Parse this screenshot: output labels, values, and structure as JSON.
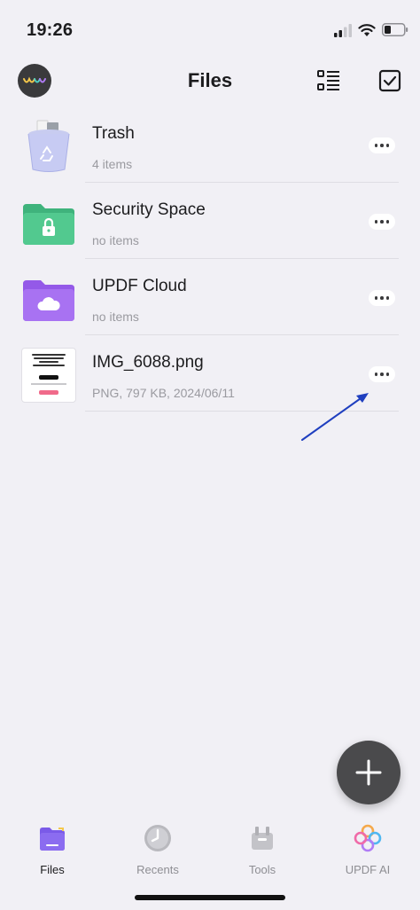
{
  "status_bar": {
    "time": "19:26"
  },
  "header": {
    "title": "Files"
  },
  "files": [
    {
      "name": "Trash",
      "meta": "4 items",
      "icon": "trash-bin-icon"
    },
    {
      "name": "Security Space",
      "meta": "no items",
      "icon": "lock-folder-icon"
    },
    {
      "name": "UPDF Cloud",
      "meta": "no items",
      "icon": "cloud-folder-icon"
    },
    {
      "name": "IMG_6088.png",
      "meta": "PNG, 797 KB, 2024/06/11",
      "icon": "image-thumbnail"
    }
  ],
  "tabs": [
    {
      "label": "Files",
      "icon": "files-folder-icon",
      "active": true
    },
    {
      "label": "Recents",
      "icon": "clock-icon",
      "active": false
    },
    {
      "label": "Tools",
      "icon": "toolbox-icon",
      "active": false
    },
    {
      "label": "UPDF AI",
      "icon": "ai-flower-icon",
      "active": false
    }
  ],
  "colors": {
    "background": "#f1f0f5",
    "security_folder": "#4fc38a",
    "cloud_folder": "#a46bf0",
    "files_tab": "#8b6cf0",
    "fab": "#4a4a4c",
    "annotation_arrow": "#1f3fbf"
  }
}
